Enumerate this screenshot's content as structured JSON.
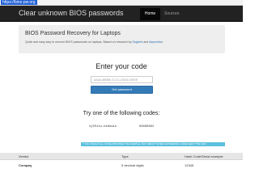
{
  "browser": {
    "url": "https://bios-pw.org"
  },
  "navbar": {
    "brand": "Clear unknown BIOS passwords",
    "items": [
      {
        "label": "Home",
        "active": true
      },
      {
        "label": "Sources",
        "active": false
      }
    ]
  },
  "jumbotron": {
    "title": "BIOS Password Recovery for Laptops",
    "description": "Quick and easy way to recover BIOS passwords on laptops. Based on research by",
    "link1": "Dogbert",
    "connector": "and",
    "link2": "Asyncritus."
  },
  "code_form": {
    "title": "Enter your code",
    "placeholder": "AAAA-BBBB-CCCC-DDDD-EEEE",
    "button": "Get password"
  },
  "samples": {
    "title": "Try one of the following codes:",
    "codes": [
      "nj55i1u-b1mkwiu",
      "64690392"
    ]
  },
  "notice": "* YOU HAVE FULL CODE PROVIDE THE SAMPLE, NOT ABOUT WHEN EXTENDING CODE SENT THE WAY.",
  "table": {
    "headers": [
      "Vendor",
      "Type",
      "Hash Code/Serial example"
    ],
    "rows": [
      [
        "Compaq",
        "5 decimal digits",
        "12345"
      ]
    ]
  },
  "colors": {
    "navbar": "#222222",
    "primary": "#337ab7",
    "info": "#5bc0de",
    "link": "#2a6fb5"
  }
}
